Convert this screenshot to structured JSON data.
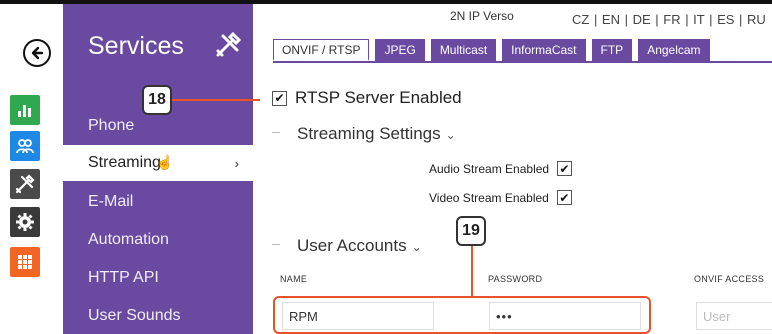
{
  "header": {
    "model": "2N IP Verso",
    "languages": "CZ | EN | DE | FR | IT | ES | RU"
  },
  "rail": {
    "icons": [
      "back-icon",
      "status-chart-icon",
      "users-icon",
      "services-tools-icon",
      "settings-gear-icon",
      "grid-apps-icon"
    ]
  },
  "services": {
    "title": "Services",
    "items": [
      {
        "label": "Phone"
      },
      {
        "label": "Streaming",
        "active": true,
        "chevron": "›"
      },
      {
        "label": "E-Mail"
      },
      {
        "label": "Automation"
      },
      {
        "label": "HTTP API"
      },
      {
        "label": "User Sounds"
      }
    ]
  },
  "tabs": [
    {
      "label": "ONVIF / RTSP",
      "active": true
    },
    {
      "label": "JPEG"
    },
    {
      "label": "Multicast"
    },
    {
      "label": "InformaCast"
    },
    {
      "label": "FTP"
    },
    {
      "label": "Angelcam"
    }
  ],
  "content": {
    "rtsp_label": "RTSP Server Enabled",
    "rtsp_checked": true,
    "streaming_settings": "Streaming Settings",
    "audio_label": "Audio Stream Enabled",
    "audio_checked": true,
    "video_label": "Video Stream Enabled",
    "video_checked": true,
    "user_accounts": "User Accounts",
    "columns": {
      "name": "NAME",
      "password": "PASSWORD",
      "onvif": "ONVIF ACCESS"
    },
    "row": {
      "name": "RPM",
      "password": "•••",
      "onvif_placeholder": "User"
    }
  },
  "annotations": {
    "callout_a": "18",
    "callout_b": "19"
  },
  "colors": {
    "purple": "#6a4aa0",
    "highlight": "#e8532c",
    "green": "#2fa84f",
    "blue": "#1e88e5",
    "orange": "#f26522"
  }
}
